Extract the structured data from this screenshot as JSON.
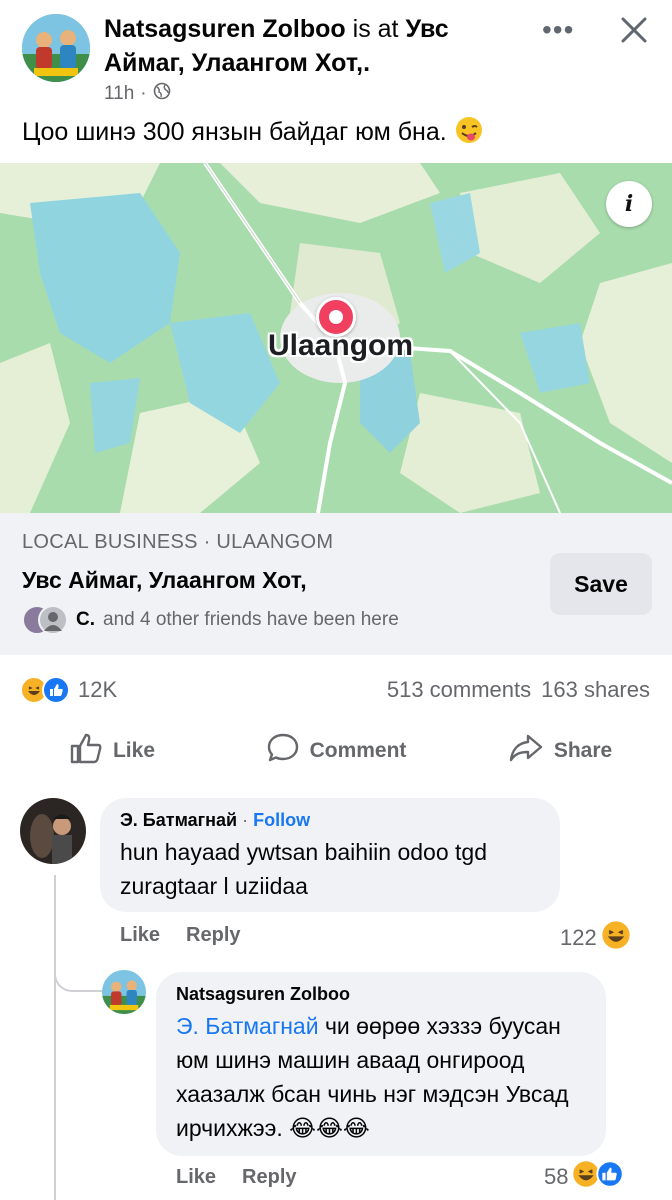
{
  "post": {
    "author": "Natsagsuren Zolboo",
    "is_at": "is at",
    "location_line1": "Увс",
    "location_line2": "Аймаг, Улаангом Хот,.",
    "time": "11h",
    "caption": "Цоо шинэ 300 янзын байдаг юм бна.",
    "caption_emoji": "winking-face-with-tongue"
  },
  "map": {
    "place_label": "Ulaangom",
    "info_glyph": "i",
    "colors": {
      "land": "#a8dcae",
      "water": "#8fd3e0",
      "road": "#ffffff"
    }
  },
  "business": {
    "category": "LOCAL BUSINESS · ULAANGOM",
    "name": "Увс Аймаг, Улаангом Хот,",
    "save_label": "Save",
    "friend_initial": "C.",
    "friends_text": "and 4 other friends have been here"
  },
  "reactions": {
    "count": "12K",
    "comments": "513 comments",
    "shares": "163 shares",
    "types": [
      "haha",
      "like"
    ]
  },
  "actions": {
    "like": "Like",
    "comment": "Comment",
    "share": "Share"
  },
  "comments": [
    {
      "author": "Э. Батмагнай",
      "follow": "Follow",
      "text": "hun hayaad ywtsan baihiin odoo tgd zuragtaar l uziidaa",
      "like_label": "Like",
      "reply_label": "Reply",
      "count": "122",
      "reaction": "haha"
    },
    {
      "author": "Natsagsuren Zolboo",
      "mention": "Э. Батмагнай",
      "text": "чи өөрөө хэззэ буусан юм шинэ машин аваад онгироод хаазалж бсан чинь нэг мэдсэн Увсад ирчихжээ.",
      "emoji_trail": "😂😂😂",
      "like_label": "Like",
      "reply_label": "Reply",
      "count": "58",
      "reactions": [
        "haha",
        "like"
      ]
    }
  ],
  "colors": {
    "accent": "#1877f2",
    "muted": "#65676b",
    "bubble": "#f0f2f5",
    "haha": "#f7b125"
  }
}
